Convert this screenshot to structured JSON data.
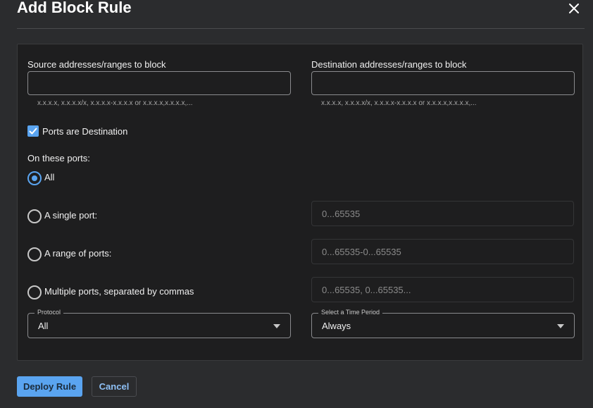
{
  "dialog": {
    "title": "Add Block Rule",
    "close_icon": "close-icon"
  },
  "source": {
    "label": "Source addresses/ranges to block",
    "value": "",
    "hint": "x.x.x.x, x.x.x.x/x, x.x.x.x-x.x.x.x or x.x.x.x,x.x.x.x,..."
  },
  "destination": {
    "label": "Destination addresses/ranges to block",
    "value": "",
    "hint": "x.x.x.x, x.x.x.x/x, x.x.x.x-x.x.x.x or x.x.x.x,x.x.x.x,..."
  },
  "ports_destination": {
    "label": "Ports are Destination",
    "checked": true
  },
  "ports": {
    "heading": "On these ports:",
    "selected": "all",
    "options": [
      {
        "id": "all",
        "label": "All"
      },
      {
        "id": "single",
        "label": "A single port:",
        "placeholder": "0...65535"
      },
      {
        "id": "range",
        "label": "A range of ports:",
        "placeholder": "0...65535-0...65535"
      },
      {
        "id": "multiple",
        "label": "Multiple ports, separated by commas",
        "placeholder": "0...65535, 0...65535..."
      }
    ]
  },
  "protocol": {
    "legend": "Protocol",
    "value": "All"
  },
  "time_period": {
    "legend": "Select a Time Period",
    "value": "Always"
  },
  "actions": {
    "deploy_label": "Deploy Rule",
    "cancel_label": "Cancel"
  },
  "colors": {
    "accent": "#5aa4f0",
    "background": "#2b2c2e",
    "panel": "#1e1e1f"
  }
}
